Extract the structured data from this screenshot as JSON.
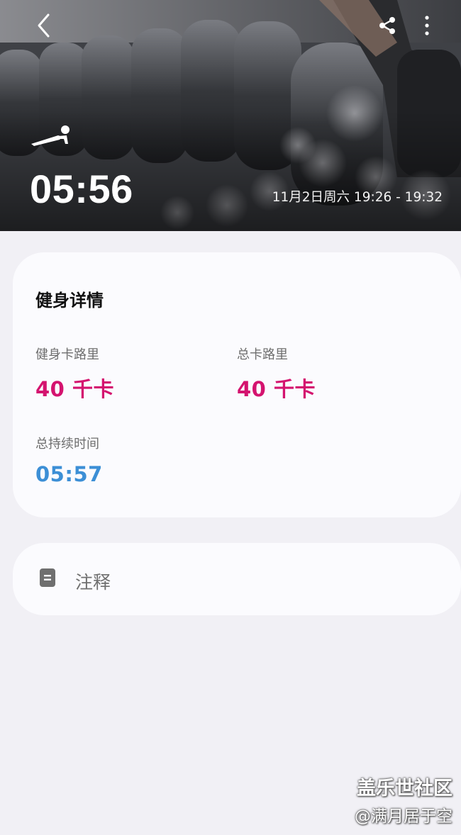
{
  "header": {
    "back_icon": "chevron-left-icon",
    "share_icon": "share-icon",
    "more_icon": "more-vertical-icon",
    "workout_icon": "push-up-icon",
    "duration": "05:56",
    "time_range": "11月2日周六 19:26 - 19:32"
  },
  "details": {
    "title": "健身详情",
    "active_calories": {
      "label": "健身卡路里",
      "value": "40 千卡",
      "color": "#d4136f"
    },
    "total_calories": {
      "label": "总卡路里",
      "value": "40 千卡",
      "color": "#d4136f"
    },
    "total_duration": {
      "label": "总持续时间",
      "value": "05:57",
      "color": "#3c8fd6"
    }
  },
  "notes": {
    "icon": "note-icon",
    "label": "注释"
  },
  "watermark": {
    "site": "盖乐世社区",
    "handle": "@满月居于空"
  }
}
